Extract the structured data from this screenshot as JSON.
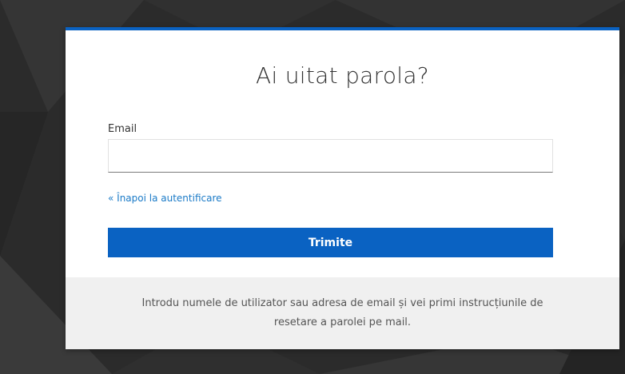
{
  "colors": {
    "accent": "#0a62c2",
    "link": "#1a7ac7",
    "footer_bg": "#f0f0f0",
    "page_bg": "#2a2a2a"
  },
  "form": {
    "title": "Ai uitat parola?",
    "email_label": "Email",
    "email_value": "",
    "email_placeholder": "",
    "back_link": "« Înapoi la autentificare",
    "submit_label": "Trimite"
  },
  "footer": {
    "instructions": "Introdu numele de utilizator sau adresa de email și vei primi instrucțiunile de resetare a parolei pe mail."
  }
}
